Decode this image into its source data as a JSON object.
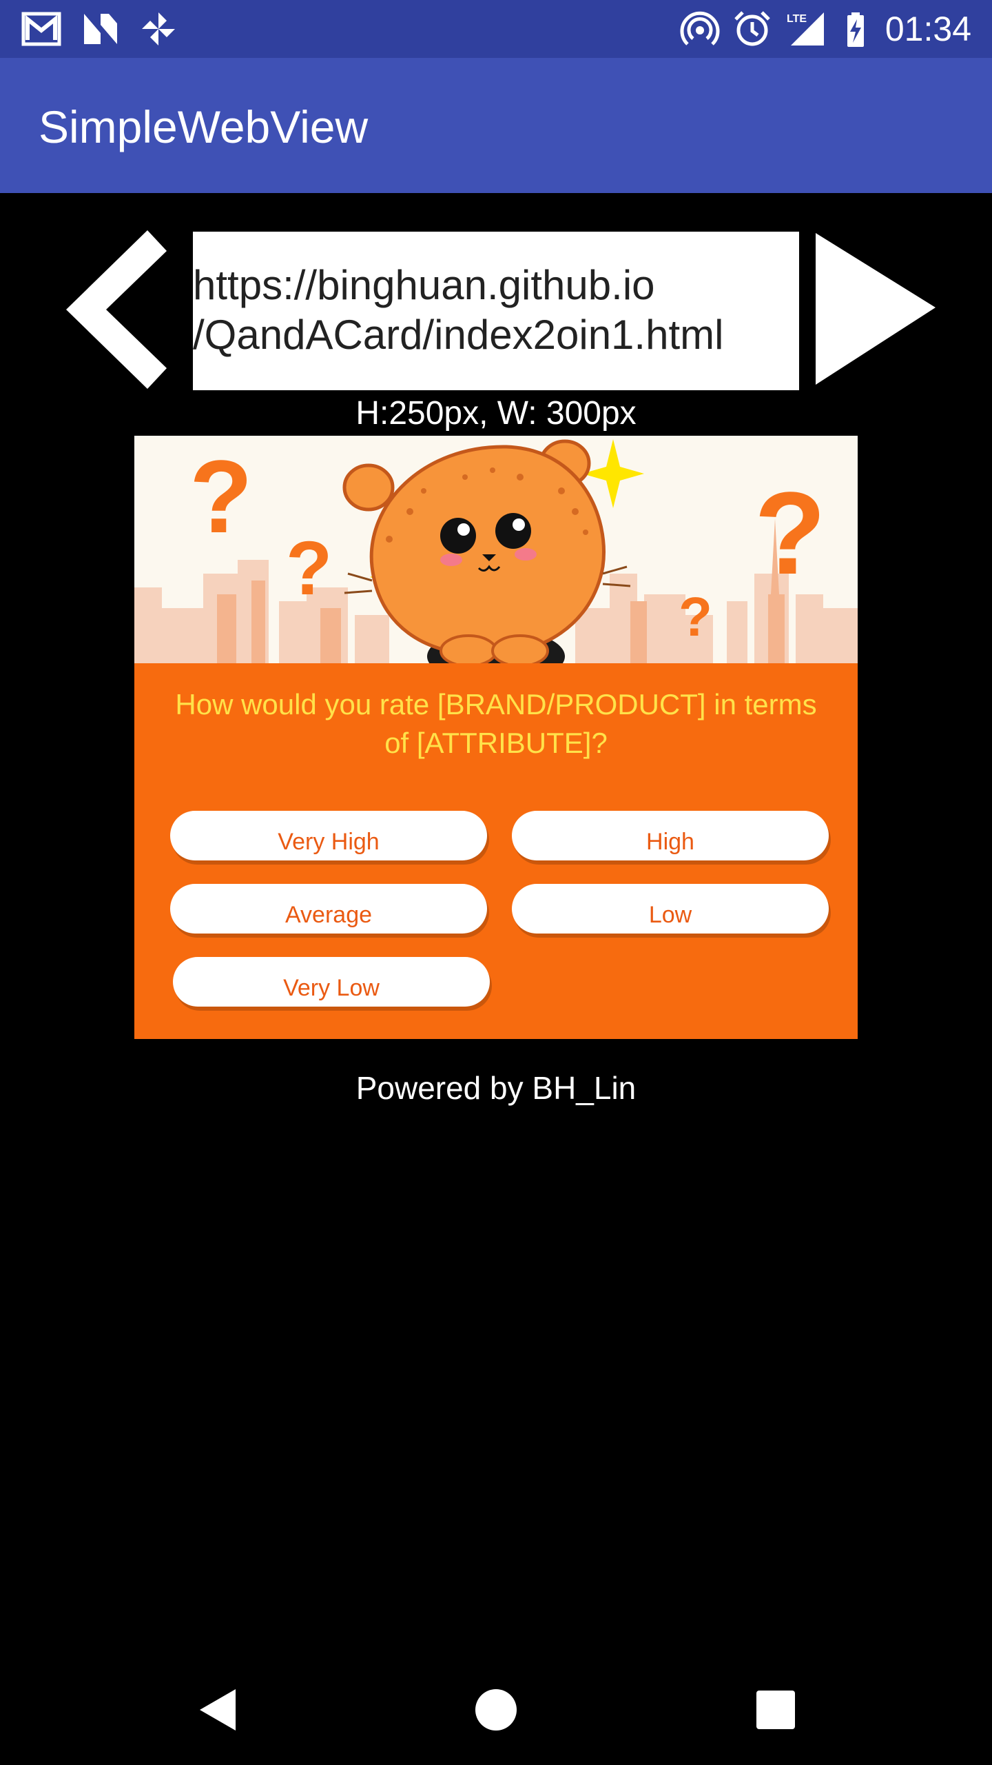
{
  "status_bar": {
    "time": "01:34",
    "network": "LTE",
    "left_icons": [
      "gmail-icon",
      "n-logo-icon",
      "pinwheel-icon"
    ],
    "right_icons": [
      "hotspot-icon",
      "alarm-icon",
      "lte-signal-icon",
      "battery-charging-icon"
    ]
  },
  "app_bar": {
    "title": "SimpleWebView"
  },
  "browser": {
    "url_line1": "https://binghuan.github.io",
    "url_line2": "/QandACard/index2oin1.html",
    "dimensions_label": "H:250px, W: 300px"
  },
  "card": {
    "question": "How would you rate [BRAND/PRODUCT] in terms of [ATTRIBUTE]?",
    "options": [
      "Very High",
      "High",
      "Average",
      "Low",
      "Very Low"
    ],
    "colors": {
      "background": "#f76b0f",
      "question_text": "#ffe24a",
      "button_text": "#ea5a12",
      "hero_bg": "#fcf8ef"
    }
  },
  "footer": {
    "powered_by": "Powered by BH_Lin"
  },
  "nav_bar": {
    "icons": [
      "back-icon",
      "home-icon",
      "recents-icon"
    ]
  }
}
